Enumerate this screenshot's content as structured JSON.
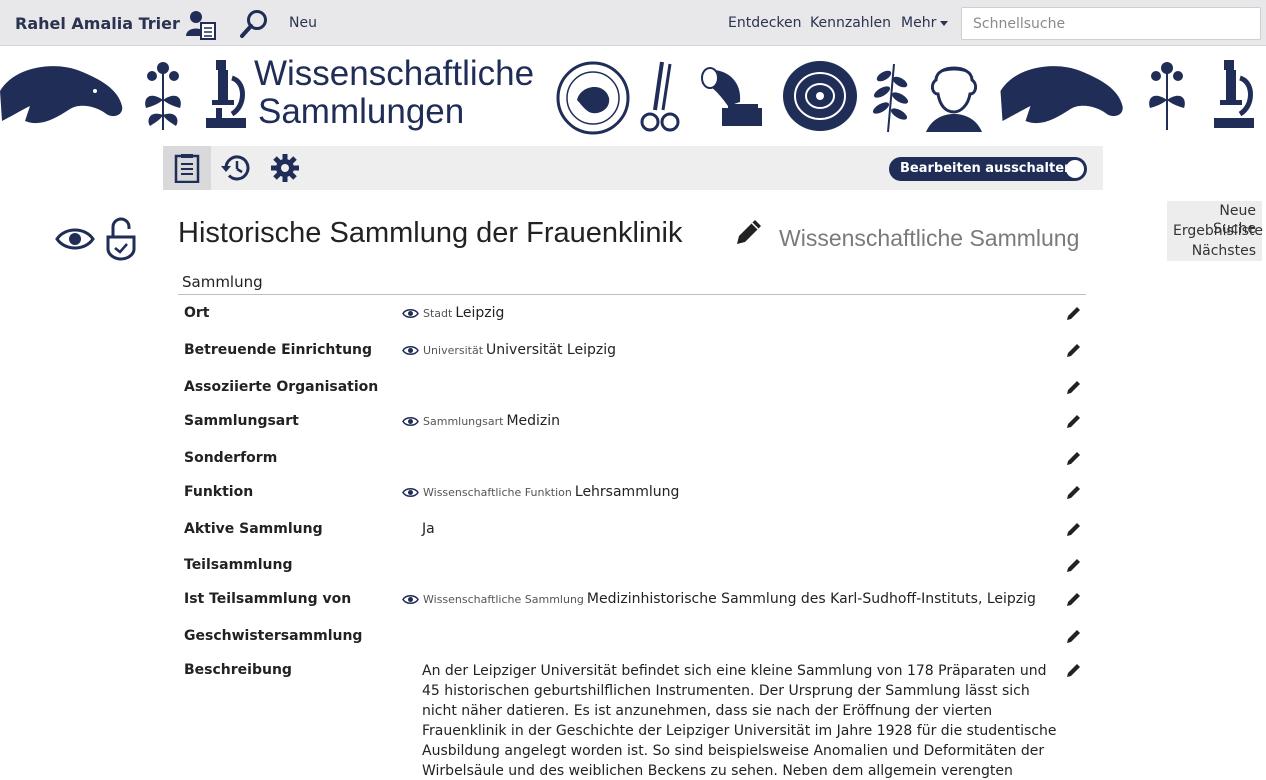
{
  "navbar": {
    "user_name": "Rahel Amalia Trier",
    "new_label": "Neu",
    "discover_label": "Entdecken",
    "metrics_label": "Kennzahlen",
    "more_label": "Mehr",
    "search_placeholder": "Schnellsuche"
  },
  "banner": {
    "title_line1": "Wissenschaftliche",
    "title_line2": "Sammlungen",
    "color": "#1f2d57"
  },
  "toolbar": {
    "edit_toggle_label": "Bearbeiten ausschalten"
  },
  "side_nav": {
    "new_search": "Neue Suche",
    "result_list": "Ergebnisliste",
    "next": "Nächstes"
  },
  "record": {
    "title": "Historische Sammlung der Frauenklinik",
    "type": "Wissenschaftliche Sammlung",
    "section": "Sammlung",
    "fields": [
      {
        "label": "Ort",
        "type": "Stadt",
        "value": "Leipzig"
      },
      {
        "label": "Betreuende Einrichtung",
        "type": "Universität",
        "value": "Universität Leipzig"
      },
      {
        "label": "Assoziierte Organisation",
        "type": "",
        "value": ""
      },
      {
        "label": "Sammlungsart",
        "type": "Sammlungsart",
        "value": "Medizin"
      },
      {
        "label": "Sonderform",
        "type": "",
        "value": ""
      },
      {
        "label": "Funktion",
        "type": "Wissenschaftliche Funktion",
        "value": "Lehrsammlung"
      },
      {
        "label": "Aktive Sammlung",
        "type": "",
        "value": "Ja"
      },
      {
        "label": "Teilsammlung",
        "type": "",
        "value": ""
      },
      {
        "label": "Ist Teilsammlung von",
        "type": "Wissenschaftliche Sammlung",
        "value": "Medizinhistorische Sammlung des Karl-Sudhoff-Instituts, Leipzig"
      },
      {
        "label": "Geschwistersammlung",
        "type": "",
        "value": ""
      },
      {
        "label": "Beschreibung",
        "type": "",
        "value": "An der Leipziger Universität befindet sich eine kleine Sammlung von 178 Präparaten und 45 historischen geburtshilflichen Instrumenten. Der Ursprung der Sammlung lässt sich nicht näher datieren. Es ist anzunehmen, dass sie nach der Eröffnung der vierten Frauenklinik in der Geschichte der Leipziger Universität im Jahre 1928 für die studentische Ausbildung angelegt worden ist. So sind beispielsweise Anomalien und Deformitäten der Wirbelsäule und des weiblichen Beckens zu sehen. Neben dem allgemein verengten Becken sind auch schief verengte"
      }
    ]
  }
}
